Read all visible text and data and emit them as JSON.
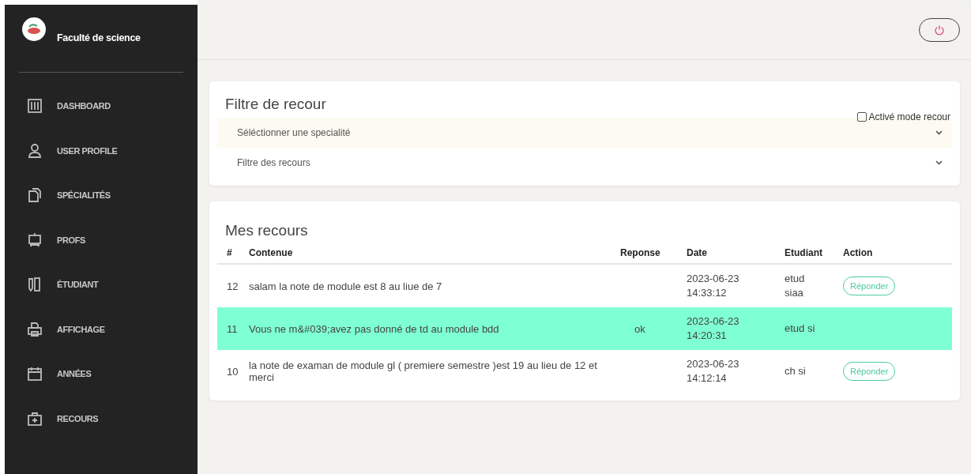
{
  "sidebar": {
    "brand": "Faculté de science",
    "items": [
      {
        "label": "DASHBOARD"
      },
      {
        "label": "USER PROFILE"
      },
      {
        "label": "SPÉCIALITÉS"
      },
      {
        "label": "PROFS"
      },
      {
        "label": "ÉTUDIANT"
      },
      {
        "label": "AFFICHAGE"
      },
      {
        "label": "ANNÉES"
      },
      {
        "label": "RECOURS"
      }
    ]
  },
  "filter": {
    "title": "Filtre de recour",
    "checkbox": {
      "label": "Activé mode recour",
      "checked": false
    },
    "selects": [
      {
        "placeholder": "Séléctionner une specialité",
        "highlighted": true
      },
      {
        "placeholder": "Filtre des recours",
        "highlighted": false
      }
    ]
  },
  "table": {
    "title": "Mes recours",
    "columns": [
      "#",
      "Contenue",
      "Reponse",
      "Date",
      "Etudiant",
      "Action"
    ],
    "rows": [
      {
        "id": "12",
        "content": "salam la note de module est 8 au liue de 7",
        "date": [
          "2023-06-23",
          "14:33:12"
        ],
        "etudiant": [
          "etud",
          "siaa"
        ],
        "action": "Réponder",
        "highlighted": false
      },
      {
        "id": "11",
        "content": "Vous ne m&#039;avez pas donné de td au module bdd",
        "reponse": "ok",
        "date": [
          "2023-06-23",
          "14:20:31"
        ],
        "etudiant": [
          "etud si"
        ],
        "highlighted": true
      },
      {
        "id": "10",
        "content": "la note de examan de module gl ( premiere semestre )est 19 au lieu de 12 et merci",
        "date": [
          "2023-06-23",
          "14:12:14"
        ],
        "etudiant": [
          "ch si"
        ],
        "action": "Réponder",
        "highlighted": false
      }
    ]
  }
}
